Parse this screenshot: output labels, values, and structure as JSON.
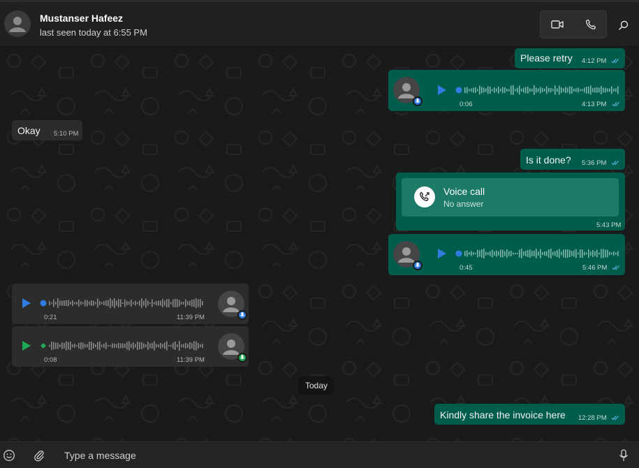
{
  "header": {
    "contact_name": "Mustanser Hafeez",
    "last_seen": "last seen today at 6:55 PM",
    "icons": [
      "avatar-icon",
      "video-call-icon",
      "voice-call-icon",
      "search-icon"
    ]
  },
  "messages": {
    "m1": {
      "text": "Please retry",
      "time": "4:12 PM",
      "status": "read"
    },
    "m2": {
      "type": "voice",
      "duration": "0:06",
      "time": "4:13 PM",
      "progress": 0
    },
    "m3": {
      "text": "Okay",
      "time": "5:10 PM"
    },
    "m4": {
      "text": "Is it done?",
      "time": "5:36 PM",
      "status": "read"
    },
    "m5": {
      "type": "call",
      "title": "Voice call",
      "subtitle": "No answer",
      "time": "5:43 PM"
    },
    "m6": {
      "type": "voice",
      "duration": "0:45",
      "time": "5:46 PM",
      "progress": 0
    },
    "m7": {
      "type": "voice",
      "duration": "0:21",
      "time": "11:39 PM",
      "progress": 0
    },
    "m8": {
      "type": "voice",
      "duration": "0:08",
      "time": "11:39 PM",
      "progress": 0,
      "played": true
    },
    "date_divider": "Today",
    "m9": {
      "text": "Kindly share the invoice here",
      "time": "12:28 PM",
      "status": "read"
    }
  },
  "composer": {
    "placeholder": "Type a message",
    "icons": [
      "emoji-icon",
      "attach-icon",
      "mic-icon"
    ]
  },
  "colors": {
    "outgoing_bubble": "#005c4b",
    "incoming_bubble": "#2c2c2c",
    "accent_blue": "#2f7de1",
    "accent_green": "#1fa855",
    "read_ticks": "#53bdeb"
  }
}
